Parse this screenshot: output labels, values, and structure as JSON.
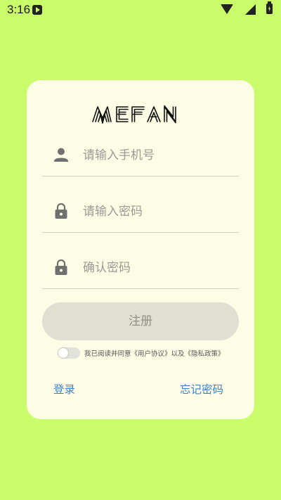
{
  "status_bar": {
    "time": "3:16",
    "icons": [
      "app-notification-icon",
      "wifi-icon",
      "signal-icon",
      "battery-charging-icon"
    ]
  },
  "brand": {
    "logo_text": "MEFAN"
  },
  "form": {
    "phone_placeholder": "请输入手机号",
    "password_placeholder": "请输入密码",
    "confirm_placeholder": "确认密码",
    "register_label": "注册",
    "agreement_text": "我已阅读并同意《用户协议》以及《隐私政策》",
    "agreement_checked": false
  },
  "links": {
    "login": "登录",
    "forgot_password": "忘记密码"
  },
  "colors": {
    "background": "#c9fb6a",
    "card": "#fdfde6",
    "link": "#3b82c9",
    "button": "#e0dfd1"
  }
}
